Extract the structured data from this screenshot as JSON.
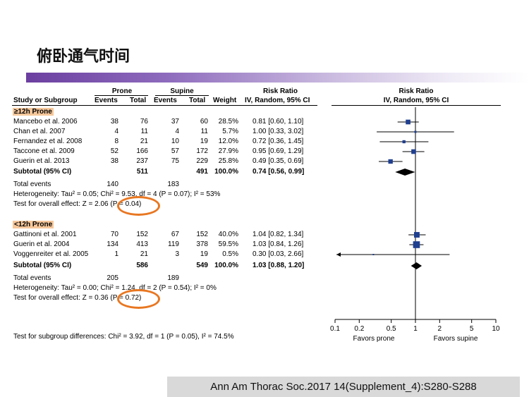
{
  "title": "俯卧通气时间",
  "citation": "Ann Am Thorac Soc.2017 14(Supplement_4):S280-S288",
  "headers": {
    "study": "Study or Subgroup",
    "prone": "Prone",
    "supine": "Supine",
    "events": "Events",
    "total": "Total",
    "weight": "Weight",
    "rr": "Risk Ratio",
    "rr_method": "IV, Random, 95% CI"
  },
  "groups": [
    {
      "label": "≥12h Prone",
      "studies": [
        {
          "name": "Mancebo et al. 2006",
          "pe": "38",
          "pt": "76",
          "se": "37",
          "st": "60",
          "w": "28.5%",
          "ci": "0.81 [0.60, 1.10]"
        },
        {
          "name": "Chan et al. 2007",
          "pe": "4",
          "pt": "11",
          "se": "4",
          "st": "11",
          "w": "5.7%",
          "ci": "1.00 [0.33, 3.02]"
        },
        {
          "name": "Fernandez et al. 2008",
          "pe": "8",
          "pt": "21",
          "se": "10",
          "st": "19",
          "w": "12.0%",
          "ci": "0.72 [0.36, 1.45]"
        },
        {
          "name": "Taccone et al. 2009",
          "pe": "52",
          "pt": "166",
          "se": "57",
          "st": "172",
          "w": "27.9%",
          "ci": "0.95 [0.69, 1.29]"
        },
        {
          "name": "Guerin et al. 2013",
          "pe": "38",
          "pt": "237",
          "se": "75",
          "st": "229",
          "w": "25.8%",
          "ci": "0.49 [0.35, 0.69]"
        }
      ],
      "subtotal": {
        "label": "Subtotal (95% CI)",
        "pt": "511",
        "st": "491",
        "w": "100.0%",
        "ci": "0.74 [0.56, 0.99]"
      },
      "total_events": {
        "label": "Total events",
        "pe": "140",
        "se": "183"
      },
      "heterogeneity": "Heterogeneity: Tau² = 0.05; Chi² = 9.53, df = 4 (P = 0.07); I² = 53%",
      "overall": "Test for overall effect: Z = 2.06 (P = 0.04)"
    },
    {
      "label": "<12h Prone",
      "studies": [
        {
          "name": "Gattinoni et al. 2001",
          "pe": "70",
          "pt": "152",
          "se": "67",
          "st": "152",
          "w": "40.0%",
          "ci": "1.04 [0.82, 1.34]"
        },
        {
          "name": "Guerin et al. 2004",
          "pe": "134",
          "pt": "413",
          "se": "119",
          "st": "378",
          "w": "59.5%",
          "ci": "1.03 [0.84, 1.26]"
        },
        {
          "name": "Voggenreiter et al. 2005",
          "pe": "1",
          "pt": "21",
          "se": "3",
          "st": "19",
          "w": "0.5%",
          "ci": "0.30 [0.03, 2.66]"
        }
      ],
      "subtotal": {
        "label": "Subtotal (95% CI)",
        "pt": "586",
        "st": "549",
        "w": "100.0%",
        "ci": "1.03 [0.88, 1.20]"
      },
      "total_events": {
        "label": "Total events",
        "pe": "205",
        "se": "189"
      },
      "heterogeneity": "Heterogeneity: Tau² = 0.00; Chi² = 1.24, df = 2 (P = 0.54); I² = 0%",
      "overall": "Test for overall effect: Z = 0.36 (P = 0.72)"
    }
  ],
  "subgroup_test": "Test for subgroup differences: Chi² = 3.92, df = 1 (P = 0.05), I² = 74.5%",
  "highlight_color": "#e87722",
  "marker_color": "#1f3f8f",
  "chart_data": {
    "type": "forest",
    "xscale": "log",
    "xlim": [
      0.1,
      10
    ],
    "ticks": [
      "0.1",
      "0.2",
      "0.5",
      "1",
      "2",
      "5",
      "10"
    ],
    "tick_values": [
      0.1,
      0.2,
      0.5,
      1,
      2,
      5,
      10
    ],
    "xlabel_left": "Favors prone",
    "xlabel_right": "Favors supine",
    "title": "Risk Ratio",
    "subtitle": "IV, Random, 95% CI",
    "points": [
      {
        "rr": 0.81,
        "lo": 0.6,
        "hi": 1.1,
        "w": 28.5
      },
      {
        "rr": 1.0,
        "lo": 0.33,
        "hi": 3.02,
        "w": 5.7
      },
      {
        "rr": 0.72,
        "lo": 0.36,
        "hi": 1.45,
        "w": 12.0
      },
      {
        "rr": 0.95,
        "lo": 0.69,
        "hi": 1.29,
        "w": 27.9
      },
      {
        "rr": 0.49,
        "lo": 0.35,
        "hi": 0.69,
        "w": 25.8
      },
      {
        "diamond": true,
        "rr": 0.74,
        "lo": 0.56,
        "hi": 0.99
      },
      {
        "rr": 1.04,
        "lo": 0.82,
        "hi": 1.34,
        "w": 40.0
      },
      {
        "rr": 1.03,
        "lo": 0.84,
        "hi": 1.26,
        "w": 59.5
      },
      {
        "rr": 0.3,
        "lo": 0.03,
        "hi": 2.66,
        "w": 0.5
      },
      {
        "diamond": true,
        "rr": 1.03,
        "lo": 0.88,
        "hi": 1.2
      }
    ]
  }
}
